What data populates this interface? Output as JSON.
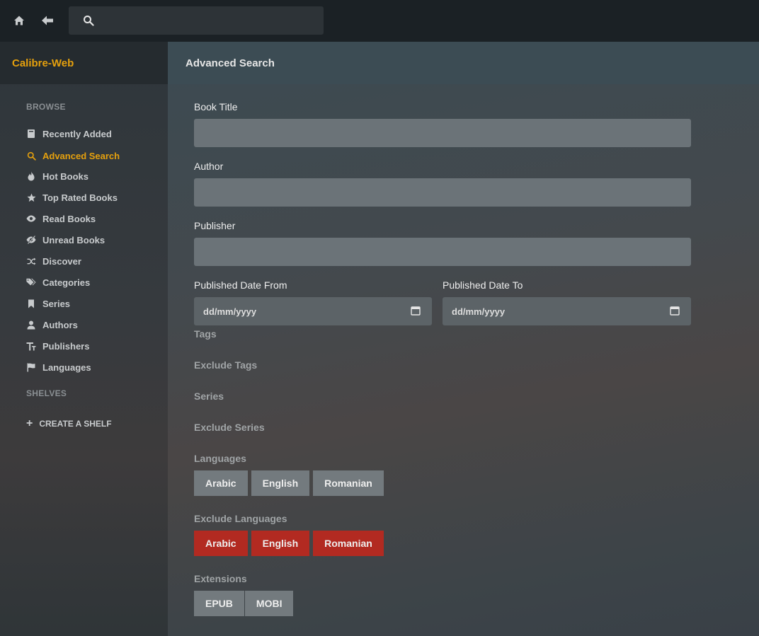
{
  "topbar": {
    "home_icon": "home-icon",
    "back_icon": "back-arrow-icon",
    "search_icon": "search-icon",
    "search_placeholder": ""
  },
  "sidebar": {
    "brand": "Calibre-Web",
    "browse_title": "BROWSE",
    "items": [
      {
        "label": "Recently Added",
        "icon": "book-icon"
      },
      {
        "label": "Advanced Search",
        "icon": "search-icon",
        "active": true
      },
      {
        "label": "Hot Books",
        "icon": "fire-icon"
      },
      {
        "label": "Top Rated Books",
        "icon": "star-icon"
      },
      {
        "label": "Read Books",
        "icon": "eye-icon"
      },
      {
        "label": "Unread Books",
        "icon": "eye-slash-icon"
      },
      {
        "label": "Discover",
        "icon": "shuffle-icon"
      },
      {
        "label": "Categories",
        "icon": "tags-icon"
      },
      {
        "label": "Series",
        "icon": "bookmark-icon"
      },
      {
        "label": "Authors",
        "icon": "user-icon"
      },
      {
        "label": "Publishers",
        "icon": "text-size-icon"
      },
      {
        "label": "Languages",
        "icon": "flag-icon"
      }
    ],
    "shelves_title": "SHELVES",
    "create_shelf": "CREATE A SHELF"
  },
  "main": {
    "title": "Advanced Search",
    "book_title_label": "Book Title",
    "author_label": "Author",
    "publisher_label": "Publisher",
    "date_from_label": "Published Date From",
    "date_to_label": "Published Date To",
    "date_from_value": "dd/mm/yyyy",
    "date_to_value": "dd/mm/yyyy",
    "tags_label": "Tags",
    "exclude_tags_label": "Exclude Tags",
    "series_label": "Series",
    "exclude_series_label": "Exclude Series",
    "languages_label": "Languages",
    "languages": [
      "Arabic",
      "English",
      "Romanian"
    ],
    "exclude_languages_label": "Exclude Languages",
    "exclude_languages": [
      "Arabic",
      "English",
      "Romanian"
    ],
    "extensions_label": "Extensions",
    "extensions": [
      "EPUB",
      "MOBI"
    ]
  },
  "colors": {
    "accent": "#e5a00d",
    "exclude_red": "#b22a21",
    "pill_gray": "#737a7e"
  }
}
